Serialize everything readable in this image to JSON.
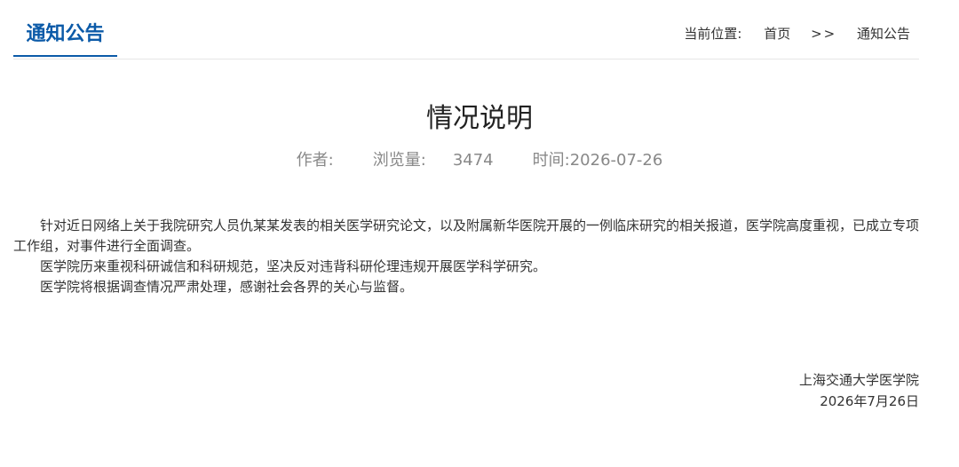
{
  "header": {
    "section_title": "通知公告",
    "breadcrumb": {
      "label": "当前位置:",
      "home": "首页",
      "separator": ">>",
      "current": "通知公告"
    }
  },
  "article": {
    "title": "情况说明",
    "meta": {
      "author_label": "作者:",
      "author_value": "",
      "views_label": "浏览量:",
      "views_value": "3474",
      "time_label": "时间:",
      "time_value": "2026-07-26"
    },
    "paragraphs": [
      "针对近日网络上关于我院研究人员仇某某发表的相关医学研究论文，以及附属新华医院开展的一例临床研究的相关报道，医学院高度重视，已成立专项工作组，对事件进行全面调查。",
      "医学院历来重视科研诚信和科研规范，坚决反对违背科研伦理违规开展医学科学研究。",
      "医学院将根据调查情况严肃处理，感谢社会各界的关心与监督。"
    ],
    "signature": {
      "org": "上海交通大学医学院",
      "date": "2026年7月26日"
    }
  },
  "colors": {
    "accent": "#0b5aa8",
    "text": "#333333",
    "meta": "#888888",
    "divider": "#e6e6e6"
  }
}
